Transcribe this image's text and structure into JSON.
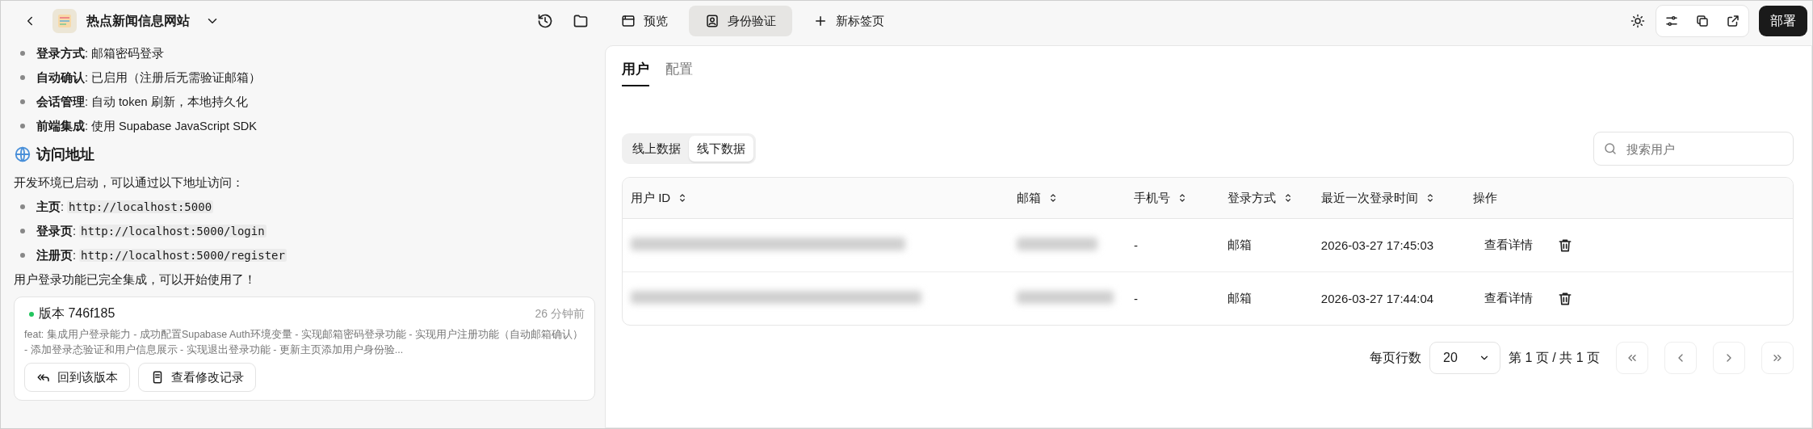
{
  "project": {
    "title": "热点新闻信息网站"
  },
  "tabs": [
    {
      "label": "预览",
      "selected": false
    },
    {
      "label": "身份验证",
      "selected": true
    },
    {
      "label": "新标签页",
      "selected": false
    }
  ],
  "deploy_button": "部署",
  "chat": [
    {
      "kind": "bullet",
      "text": "**登录方式**: 邮箱密码登录"
    },
    {
      "kind": "bullet",
      "text": "**自动确认**: 已启用（注册后无需验证邮箱）"
    },
    {
      "kind": "bullet",
      "text": "**会话管理**: 自动 token 刷新，本地持久化"
    },
    {
      "kind": "bullet",
      "text": "**前端集成**: 使用 Supabase JavaScript SDK"
    },
    {
      "kind": "heading",
      "text": "访问地址"
    },
    {
      "kind": "paragraph",
      "text": "开发环境已启动，可以通过以下地址访问："
    },
    {
      "kind": "bullet",
      "text": "**主页**:",
      "code": "http://localhost:5000"
    },
    {
      "kind": "bullet",
      "text": "**登录页**:",
      "code": "http://localhost:5000/login"
    },
    {
      "kind": "bullet",
      "text": "**注册页**:",
      "code": "http://localhost:5000/register"
    },
    {
      "kind": "paragraph",
      "text": "用户登录功能已完全集成，可以开始使用了！"
    }
  ],
  "version_card": {
    "title": "版本 746f185",
    "time": "26 分钟前",
    "message": "feat: 集成用户登录能力 - 成功配置Supabase Auth环境变量 - 实现邮箱密码登录功能 - 实现用户注册功能（自动邮箱确认） - 添加登录态验证和用户信息展示 - 实现退出登录功能 - 更新主页添加用户身份验...",
    "buttons": [
      {
        "label": "回到该版本"
      },
      {
        "label": "查看修改记录"
      }
    ]
  },
  "subtabs": [
    {
      "label": "用户",
      "selected": true
    },
    {
      "label": "配置",
      "selected": false
    }
  ],
  "data_source": [
    {
      "label": "线上数据",
      "selected": false
    },
    {
      "label": "线下数据",
      "selected": true
    }
  ],
  "search": {
    "placeholder": "搜索用户"
  },
  "table": {
    "columns": [
      {
        "label": "用户 ID",
        "sortable": true
      },
      {
        "label": "邮箱",
        "sortable": true
      },
      {
        "label": "手机号",
        "sortable": true
      },
      {
        "label": "登录方式",
        "sortable": true
      },
      {
        "label": "最近一次登录时间",
        "sortable": true
      },
      {
        "label": "操作",
        "sortable": false
      }
    ],
    "rows": [
      {
        "phone": "-",
        "login_method": "邮箱",
        "last_login": "2026-03-27 17:45:03",
        "action": "查看详情"
      },
      {
        "phone": "-",
        "login_method": "邮箱",
        "last_login": "2026-03-27 17:44:04",
        "action": "查看详情"
      }
    ]
  },
  "pagination": {
    "rows_per_page_label": "每页行数",
    "page_size": "20",
    "page_info": "第 1 页 / 共 1 页"
  }
}
